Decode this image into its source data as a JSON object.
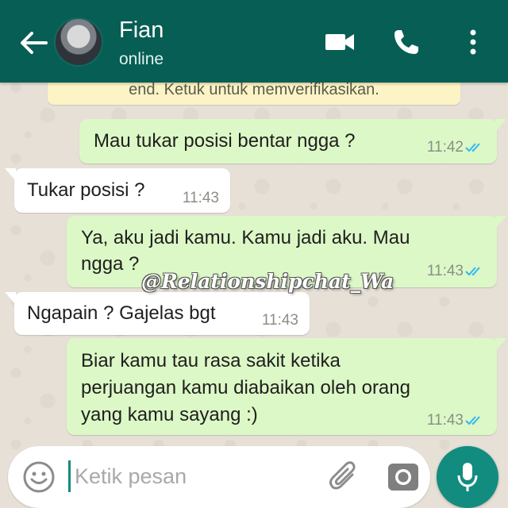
{
  "header": {
    "contact_name": "Fian",
    "status": "online",
    "icons": [
      "back-arrow-icon",
      "avatar",
      "video-call-icon",
      "phone-icon",
      "more-vert-icon"
    ]
  },
  "notice": {
    "text": "end. Ketuk untuk memverifikasikan."
  },
  "messages": [
    {
      "direction": "outgoing",
      "lines": [
        "Mau tukar posisi bentar ngga ?"
      ],
      "time": "11:42",
      "read": true
    },
    {
      "direction": "incoming",
      "lines": [
        "Tukar posisi ?"
      ],
      "time": "11:43"
    },
    {
      "direction": "outgoing",
      "lines": [
        "Ya, aku jadi kamu. Kamu jadi aku. Mau",
        "ngga ?"
      ],
      "time": "11:43",
      "read": true
    },
    {
      "direction": "incoming",
      "lines": [
        "Ngapain ? Gajelas bgt"
      ],
      "time": "11:43"
    },
    {
      "direction": "outgoing",
      "lines": [
        "Biar kamu tau rasa sakit ketika",
        "perjuangan kamu diabaikan oleh orang",
        "yang kamu sayang :)"
      ],
      "time": "11:43",
      "read": true
    }
  ],
  "watermark": "@Relationshipchat_Wa",
  "composer": {
    "placeholder": "Ketik pesan",
    "value": ""
  },
  "colors": {
    "header": "#075e54",
    "outgoing_bubble": "#dcf8c6",
    "incoming_bubble": "#ffffff",
    "read_ticks": "#34b7f1",
    "mic_button": "#128c7e",
    "notice_bg": "#fdf4c5"
  }
}
